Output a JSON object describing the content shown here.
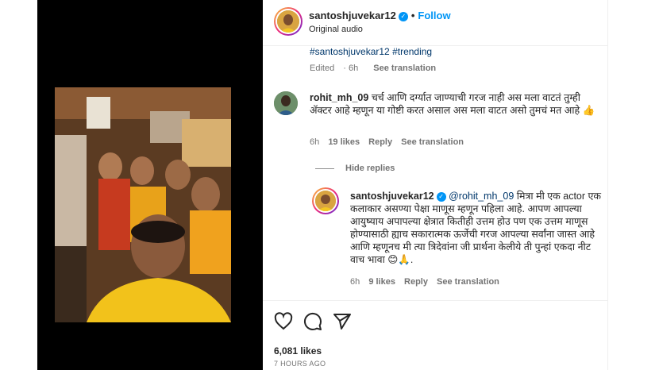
{
  "header": {
    "username": "santoshjuvekar12",
    "follow_label": "Follow",
    "dot": "•",
    "audio": "Original audio"
  },
  "caption": {
    "hashtags": "#santoshjuvekar12 #trending",
    "edited": "Edited",
    "time": "6h",
    "see_translation": "See translation"
  },
  "comment": {
    "username": "rohit_mh_09",
    "text": "चर्च आणि दर्ग्यात जाण्याची गरज नाही अस मला वाटतं तुम्ही ॲक्टर आहे म्हणून या गोष्टी करत असाल अस मला वाटत असो तुमचं मत आहे 👍",
    "time": "6h",
    "likes": "19 likes",
    "reply": "Reply",
    "see_translation": "See translation"
  },
  "hide_replies": "Hide replies",
  "reply": {
    "username": "santoshjuvekar12",
    "mention": "@rohit_mh_09",
    "text": "मित्रा मी एक actor एक कलाकार असण्या पेक्षा माणूस म्हणून पहिला आहे. आपण आपल्या आयुष्याय अपापल्या क्षेत्रात कितीही उत्तम होउ पण एक उत्तम माणूस होण्यासाठी ह्याच सकारात्मक ऊर्जेची गरज आपल्या सर्वांना जास्त आहे आणि म्हणूनच मी त्या त्रिदेवांना जी प्रार्थना केलीये ती पुन्हां एकदा नीट वाच भावा 😊🙏.",
    "time": "6h",
    "likes": "9 likes",
    "reply": "Reply",
    "see_translation": "See translation"
  },
  "actions": {
    "likes": "6,081 likes",
    "timestamp": "7 HOURS AGO",
    "icons": [
      "heart-icon",
      "comment-icon",
      "share-icon"
    ]
  },
  "colors": {
    "accent": "#0095f6",
    "link": "#00376b",
    "secondary_text": "#737373",
    "media_bg": "#000000"
  }
}
